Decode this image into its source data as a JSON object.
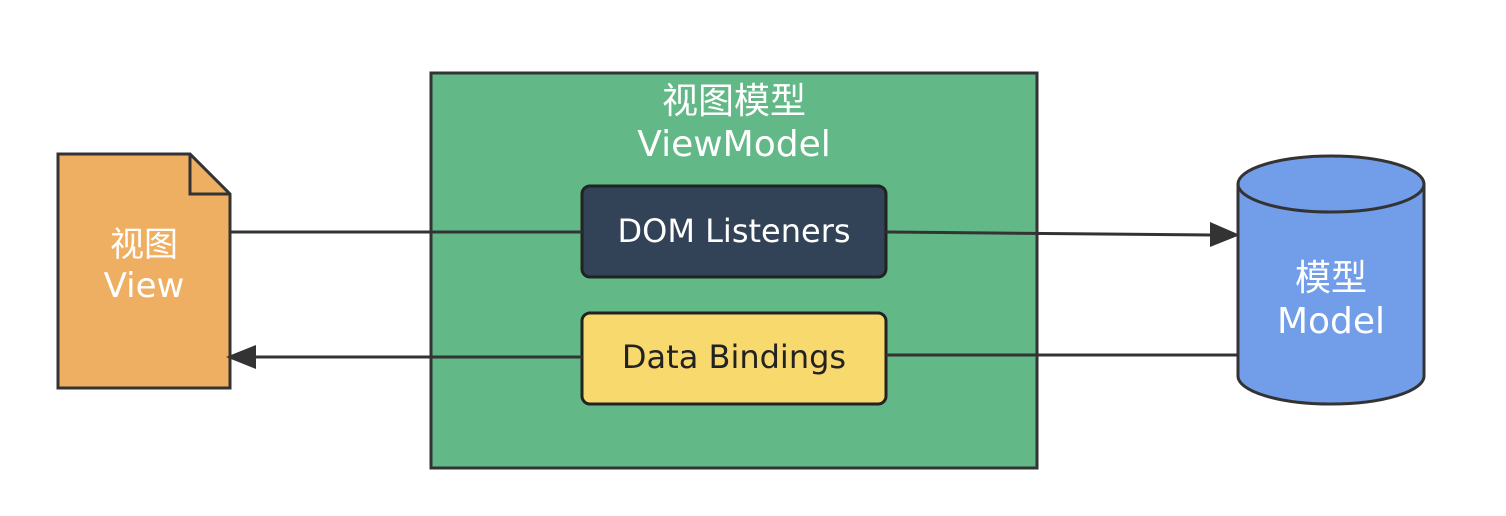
{
  "view": {
    "line1": "视图",
    "line2": "View",
    "color": "#EEAF62"
  },
  "viewmodel": {
    "line1": "视图模型",
    "line2": "ViewModel",
    "color": "#62B987"
  },
  "dom_listeners": {
    "label": "DOM Listeners",
    "color": "#334357"
  },
  "data_bindings": {
    "label": "Data Bindings",
    "color": "#F8D96E"
  },
  "model": {
    "line1": "模型",
    "line2": "Model",
    "color": "#729DE9"
  },
  "colors": {
    "stroke": "#333333",
    "edge": "#333333"
  }
}
